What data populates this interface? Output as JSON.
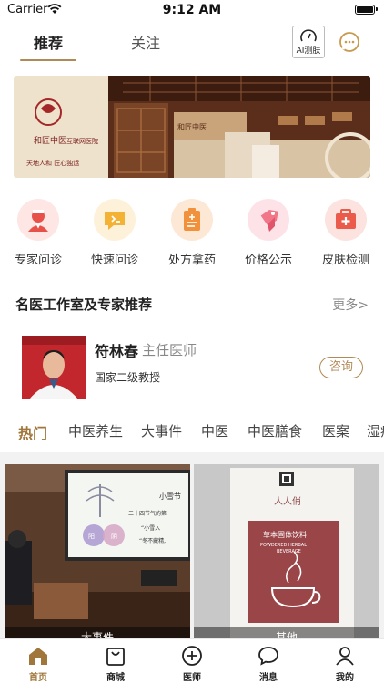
{
  "status_bar": {
    "carrier": "Carrier",
    "time": "9:12 AM"
  },
  "top_tabs": [
    {
      "label": "推荐",
      "active": true
    },
    {
      "label": "关注",
      "active": false
    }
  ],
  "ai_button": {
    "label": "AI测肤"
  },
  "banner": {
    "brand_text": "和匠中医",
    "brand_sub": "互联网医院",
    "slogan": "天地人和 匠心独运",
    "store_sign": "和匠中医"
  },
  "quick_actions": [
    {
      "label": "专家问诊",
      "icon": "doctor-icon"
    },
    {
      "label": "快速问诊",
      "icon": "quick-chat-icon"
    },
    {
      "label": "处方拿药",
      "icon": "prescription-icon"
    },
    {
      "label": "价格公示",
      "icon": "price-tag-icon"
    },
    {
      "label": "皮肤检测",
      "icon": "medical-kit-icon"
    }
  ],
  "experts_section": {
    "title": "名医工作室及专家推荐",
    "more": "更多>"
  },
  "doctor": {
    "name": "符林春",
    "title": "主任医师",
    "description": "国家二级教授",
    "consult_label": "咨询"
  },
  "categories": [
    {
      "label": "热门",
      "active": true
    },
    {
      "label": "中医养生"
    },
    {
      "label": "大事件"
    },
    {
      "label": "中医"
    },
    {
      "label": "中医膳食"
    },
    {
      "label": "医案"
    },
    {
      "label": "湿疹"
    }
  ],
  "cards": [
    {
      "caption": "大事件",
      "slide_title": "小雪节",
      "slide_line1": "二十四节气的第",
      "slide_line2": "“小雪入",
      "slide_line3": "“冬不藏精,",
      "circle_left": "阳",
      "circle_right": "阴"
    },
    {
      "caption": "其他",
      "brand": "人人俏",
      "product": "草本固体饮料",
      "product_en1": "POWDERED HERBAL",
      "product_en2": "BEVERAGE"
    }
  ],
  "bottom_nav": [
    {
      "label": "首页",
      "icon": "home-icon",
      "active": true
    },
    {
      "label": "商城",
      "icon": "shopping-bag-icon"
    },
    {
      "label": "医师",
      "icon": "plus-circle-icon"
    },
    {
      "label": "消息",
      "icon": "message-icon"
    },
    {
      "label": "我的",
      "icon": "user-icon"
    }
  ],
  "colors": {
    "accent": "#a0763a",
    "banner_wood": "#6b3a22"
  }
}
